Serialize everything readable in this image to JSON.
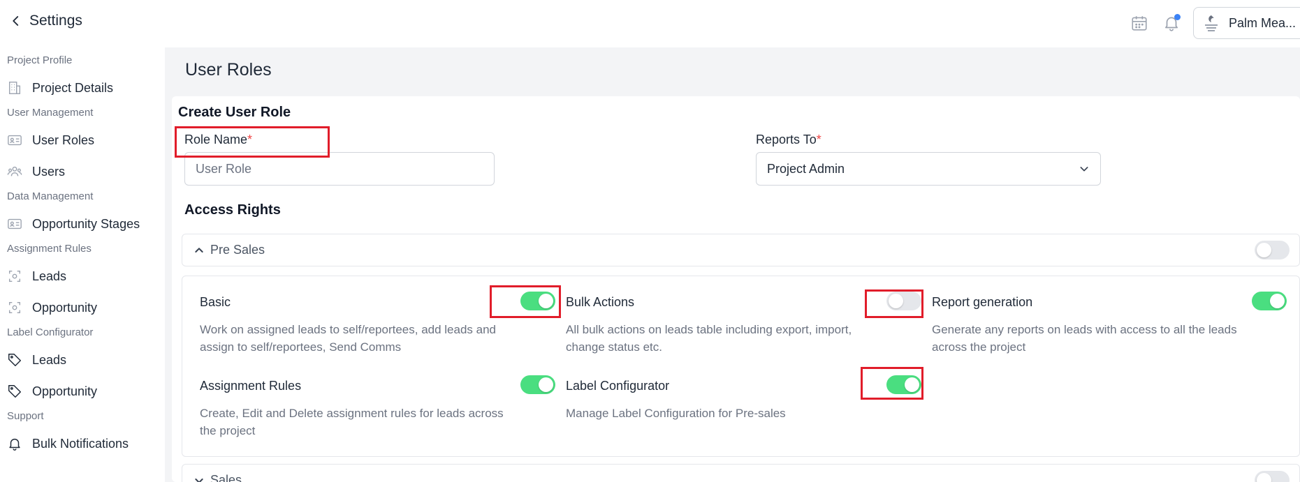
{
  "header": {
    "back_label": "Settings",
    "profile_name": "Palm Mea..."
  },
  "sidebar": {
    "sections": [
      {
        "label": "Project Profile",
        "items": [
          {
            "label": "Project Details",
            "icon": "building-icon"
          }
        ]
      },
      {
        "label": "User Management",
        "items": [
          {
            "label": "User Roles",
            "icon": "id-card-icon"
          },
          {
            "label": "Users",
            "icon": "users-icon"
          }
        ]
      },
      {
        "label": "Data Management",
        "items": [
          {
            "label": "Opportunity Stages",
            "icon": "id-card-icon"
          }
        ]
      },
      {
        "label": "Assignment Rules",
        "items": [
          {
            "label": "Leads",
            "icon": "target-icon"
          },
          {
            "label": "Opportunity",
            "icon": "target-icon"
          }
        ]
      },
      {
        "label": "Label Configurator",
        "items": [
          {
            "label": "Leads",
            "icon": "tag-icon"
          },
          {
            "label": "Opportunity",
            "icon": "tag-icon"
          }
        ]
      },
      {
        "label": "Support",
        "items": [
          {
            "label": "Bulk Notifications",
            "icon": "bell-icon"
          }
        ]
      }
    ]
  },
  "main": {
    "page_title": "User Roles",
    "card_title": "Create User Role",
    "role_name": {
      "label": "Role Name",
      "required": "*",
      "placeholder": "User Role",
      "value": ""
    },
    "reports_to": {
      "label": "Reports To",
      "required": "*",
      "value": "Project Admin"
    },
    "access_rights_title": "Access Rights",
    "accordions": [
      {
        "label": "Pre Sales",
        "expanded": true,
        "enabled": false,
        "permissions": [
          {
            "title": "Basic",
            "description": "Work on assigned leads to self/reportees, add leads and assign to self/reportees, Send Comms",
            "enabled": true
          },
          {
            "title": "Bulk Actions",
            "description": "All bulk actions on leads table including export, import, change status etc.",
            "enabled": false
          },
          {
            "title": "Report generation",
            "description": "Generate any reports on leads with access to all the leads across the project",
            "enabled": true
          },
          {
            "title": "Assignment Rules",
            "description": "Create, Edit and Delete assignment rules for leads across the project",
            "enabled": true
          },
          {
            "title": "Label Configurator",
            "description": "Manage Label Configuration for Pre-sales",
            "enabled": true
          }
        ]
      },
      {
        "label": "Sales",
        "expanded": false,
        "enabled": false
      }
    ]
  },
  "colors": {
    "toggle_on": "#4ade80",
    "toggle_off": "#e5e7eb",
    "highlight": "#e11d2a",
    "required": "#ef4444",
    "notification_dot": "#3b82f6"
  }
}
